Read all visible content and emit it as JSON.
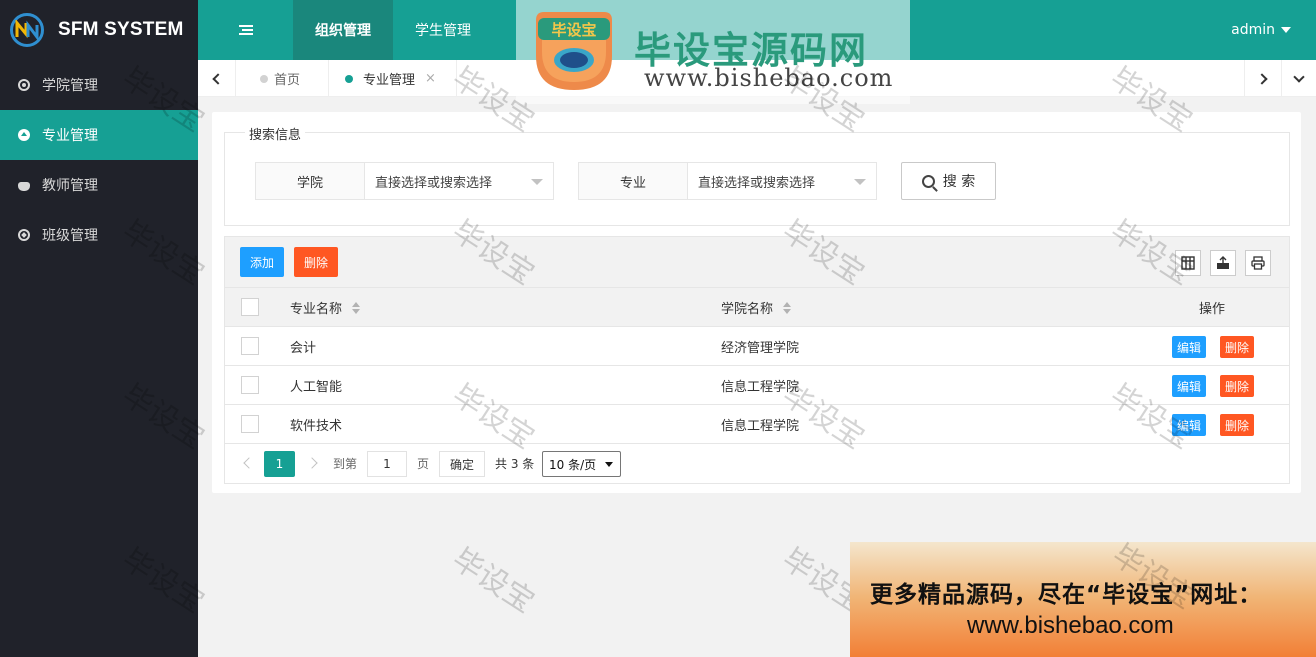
{
  "app": {
    "name": "SFM SYSTEM"
  },
  "sidebar": {
    "items": [
      {
        "label": "学院管理",
        "icon": "circle-dot-icon",
        "active": false
      },
      {
        "label": "专业管理",
        "icon": "circle-up-icon",
        "active": true
      },
      {
        "label": "教师管理",
        "icon": "cat-icon",
        "active": false
      },
      {
        "label": "班级管理",
        "icon": "compass-icon",
        "active": false
      }
    ]
  },
  "header": {
    "tabs": [
      {
        "label": "组织管理",
        "active": true
      },
      {
        "label": "学生管理",
        "active": false
      }
    ],
    "user": "admin",
    "accent_color": "#16a094"
  },
  "tabstrip": {
    "tabs": [
      {
        "label": "首页",
        "active": false
      },
      {
        "label": "专业管理",
        "active": true,
        "close": "×"
      }
    ]
  },
  "search": {
    "legend": "搜索信息",
    "fields": [
      {
        "label": "学院",
        "placeholder": "直接选择或搜索选择"
      },
      {
        "label": "专业",
        "placeholder": "直接选择或搜索选择"
      }
    ],
    "button": "搜 索"
  },
  "toolbar": {
    "add": "添加",
    "delete": "删除",
    "icons": [
      "columns-icon",
      "export-icon",
      "print-icon"
    ]
  },
  "table": {
    "headers": {
      "major": "专业名称",
      "college": "学院名称",
      "actions": "操作"
    },
    "rows": [
      {
        "major": "会计",
        "college": "经济管理学院"
      },
      {
        "major": "人工智能",
        "college": "信息工程学院"
      },
      {
        "major": "软件技术",
        "college": "信息工程学院"
      }
    ],
    "row_actions": {
      "edit": "编辑",
      "delete": "删除"
    }
  },
  "pagination": {
    "current_page": "1",
    "goto_label": "到第",
    "goto_value": "1",
    "page_unit": "页",
    "confirm": "确定",
    "total": "共 3 条",
    "page_size": "10 条/页"
  },
  "watermark": {
    "badge_text": "毕设宝",
    "site_title": "毕设宝源码网",
    "site_url": "www.bishebao.com",
    "repeat_text": "毕设宝"
  },
  "ad": {
    "line1": "更多精品源码，尽在“毕设宝”网址：",
    "line2": "www.bishebao.com"
  }
}
